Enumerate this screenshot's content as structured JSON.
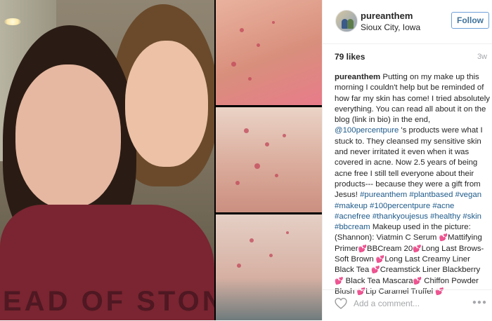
{
  "post": {
    "username": "pureanthem",
    "location": "Sioux City, Iowa",
    "follow_label": "Follow",
    "likes": "79 likes",
    "time_ago": "3w",
    "sweater_text": "EAD OF STON",
    "caption": [
      {
        "type": "author",
        "text": "pureanthem"
      },
      {
        "type": "text",
        "text": " Putting on my make up this morning I couldn't help but be reminded of how far my skin has come! I tried absolutely everything. You can read all about it on the blog (link in bio) in the end, "
      },
      {
        "type": "link",
        "text": "@100percentpure"
      },
      {
        "type": "text",
        "text": " 's products were what I stuck to. They cleansed my sensitive skin and never irritated it even when it was covered in acne. Now 2.5 years of being acne free I still tell everyone about their products--- because they were a gift from Jesus! "
      },
      {
        "type": "link",
        "text": "#pureanthem"
      },
      {
        "type": "text",
        "text": " "
      },
      {
        "type": "link",
        "text": "#plantbased"
      },
      {
        "type": "text",
        "text": " "
      },
      {
        "type": "link",
        "text": "#vegan"
      },
      {
        "type": "text",
        "text": " "
      },
      {
        "type": "link",
        "text": "#makeup"
      },
      {
        "type": "text",
        "text": " "
      },
      {
        "type": "link",
        "text": "#100percentpure"
      },
      {
        "type": "text",
        "text": " "
      },
      {
        "type": "link",
        "text": "#acne"
      },
      {
        "type": "text",
        "text": " "
      },
      {
        "type": "link",
        "text": "#acnefree"
      },
      {
        "type": "text",
        "text": " "
      },
      {
        "type": "link",
        "text": "#thankyoujesus"
      },
      {
        "type": "text",
        "text": " "
      },
      {
        "type": "link",
        "text": "#healthy"
      },
      {
        "type": "text",
        "text": " "
      },
      {
        "type": "link",
        "text": "#skin"
      },
      {
        "type": "text",
        "text": " "
      },
      {
        "type": "link",
        "text": "#bbcream"
      },
      {
        "type": "text",
        "text": " Makeup used in the picture: (Shannon): Viatmin C Serum "
      },
      {
        "type": "heart",
        "text": "💕"
      },
      {
        "type": "text",
        "text": "Mattifying Primer"
      },
      {
        "type": "heart",
        "text": "💕"
      },
      {
        "type": "text",
        "text": "BBCream 20"
      },
      {
        "type": "heart",
        "text": "💕"
      },
      {
        "type": "text",
        "text": "Long Last Brows-Soft Brown "
      },
      {
        "type": "heart",
        "text": "💕"
      },
      {
        "type": "text",
        "text": "Long Last Creamy Liner Black Tea "
      },
      {
        "type": "heart",
        "text": "💕"
      },
      {
        "type": "text",
        "text": "Creamstick Liner Blackberry "
      },
      {
        "type": "heart",
        "text": "💕"
      },
      {
        "type": "text",
        "text": " Black Tea Mascara"
      },
      {
        "type": "heart",
        "text": "💕"
      },
      {
        "type": "text",
        "text": " Chiffon Powder Blush "
      },
      {
        "type": "heart",
        "text": "💕"
      },
      {
        "type": "text",
        "text": "Lip Caramel Truffel "
      },
      {
        "type": "heart",
        "text": "💕"
      }
    ],
    "comment_placeholder": "Add a comment...",
    "more_icon": "more-options-icon",
    "like_icon": "heart-outline-icon"
  },
  "colors": {
    "follow_border": "#6fa0d8",
    "follow_text": "#3f729b",
    "link": "#1e5a8a",
    "muted": "#a5a7aa"
  }
}
